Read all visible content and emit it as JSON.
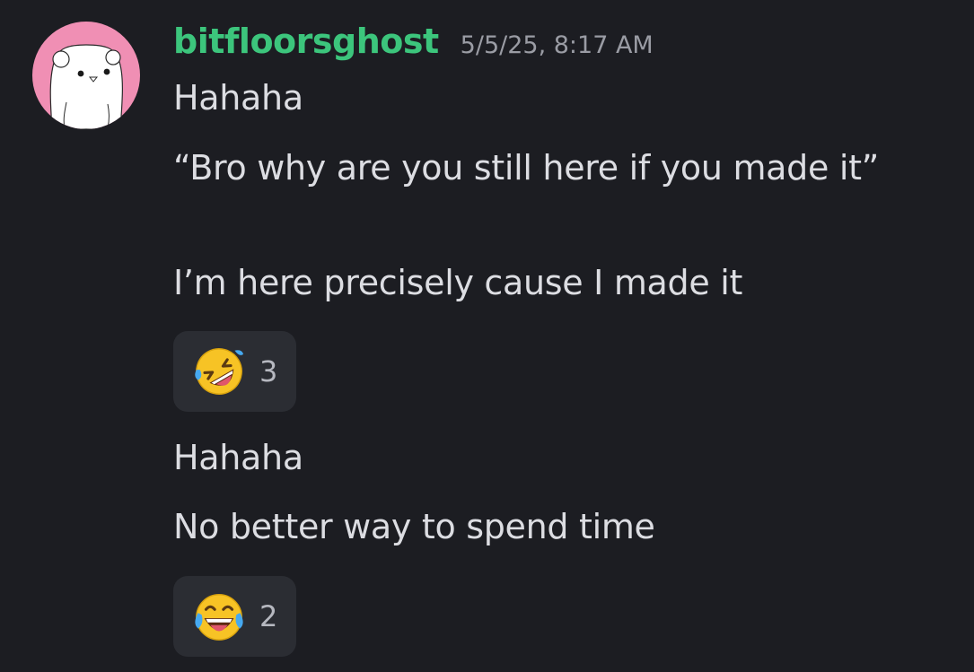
{
  "message": {
    "author": "bitfloorsghost",
    "timestamp": "5/5/25, 8:17 AM",
    "lines": [
      "Hahaha",
      "“Bro why are you still here if you made it”",
      "I’m here precisely cause I made it"
    ],
    "reactions": [
      {
        "emoji": "rolling-on-floor-laughing",
        "count": "3"
      }
    ]
  },
  "followup": {
    "lines": [
      "Hahaha",
      "No better way to spend time"
    ],
    "reactions": [
      {
        "emoji": "face-with-tears-of-joy",
        "count": "2"
      }
    ]
  },
  "colors": {
    "background": "#1c1d22",
    "username": "#3cc57c",
    "avatar_bg": "#f08fb4",
    "reaction_bg": "#2b2d33"
  }
}
